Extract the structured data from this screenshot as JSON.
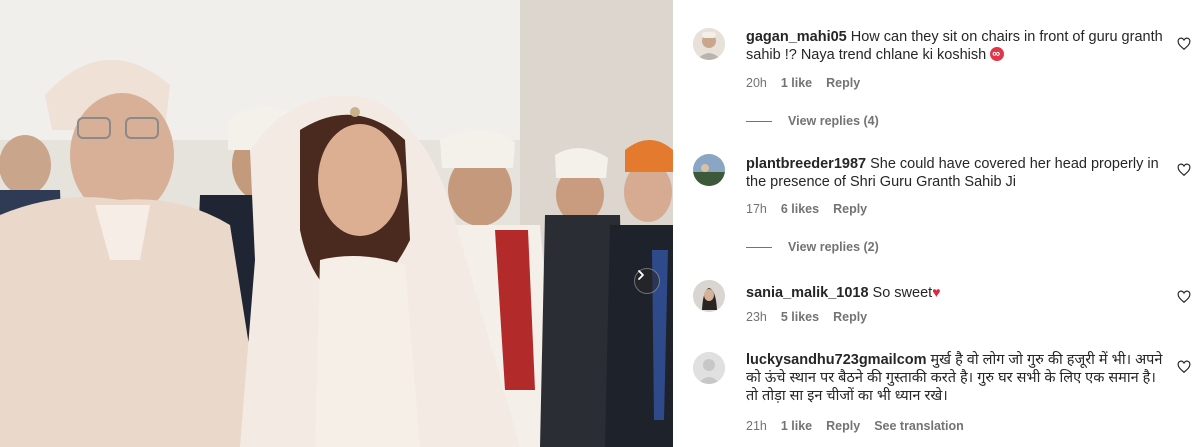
{
  "comments": [
    {
      "username": "gagan_mahi05",
      "text": "How can they sit on chairs in front of guru granth sahib !? Naya trend chlane ki koshish",
      "emoji": "red-infinity-emoji",
      "time": "20h",
      "likes": "1 like",
      "reply": "Reply",
      "view_replies": "View replies (4)"
    },
    {
      "username": "plantbreeder1987",
      "text": "She could have covered her head properly in the presence of Shri Guru Granth Sahib Ji",
      "time": "17h",
      "likes": "6 likes",
      "reply": "Reply",
      "view_replies": "View replies (2)"
    },
    {
      "username": "sania_malik_1018",
      "text": "So sweet",
      "emoji": "red-heart-emoji",
      "time": "23h",
      "likes": "5 likes",
      "reply": "Reply"
    },
    {
      "username": "luckysandhu723gmailcom",
      "text": "मुर्ख है वो लोग जो गुरु की हजूरी में भी। अपने को ऊंचे स्थान पर बैठने की गुस्ताकी करते है। गुरु घर सभी के लिए एक समान है। तो तोड़ा सा इन चीजों का भी ध्यान रखे।",
      "time": "21h",
      "likes": "1 like",
      "reply": "Reply",
      "see_translation": "See translation"
    }
  ],
  "colors": {
    "text": "#262626",
    "muted": "#737373",
    "heart_red": "#e0243d"
  },
  "icons": [
    "like-heart-outline-icon",
    "carousel-next-chevron-icon"
  ]
}
